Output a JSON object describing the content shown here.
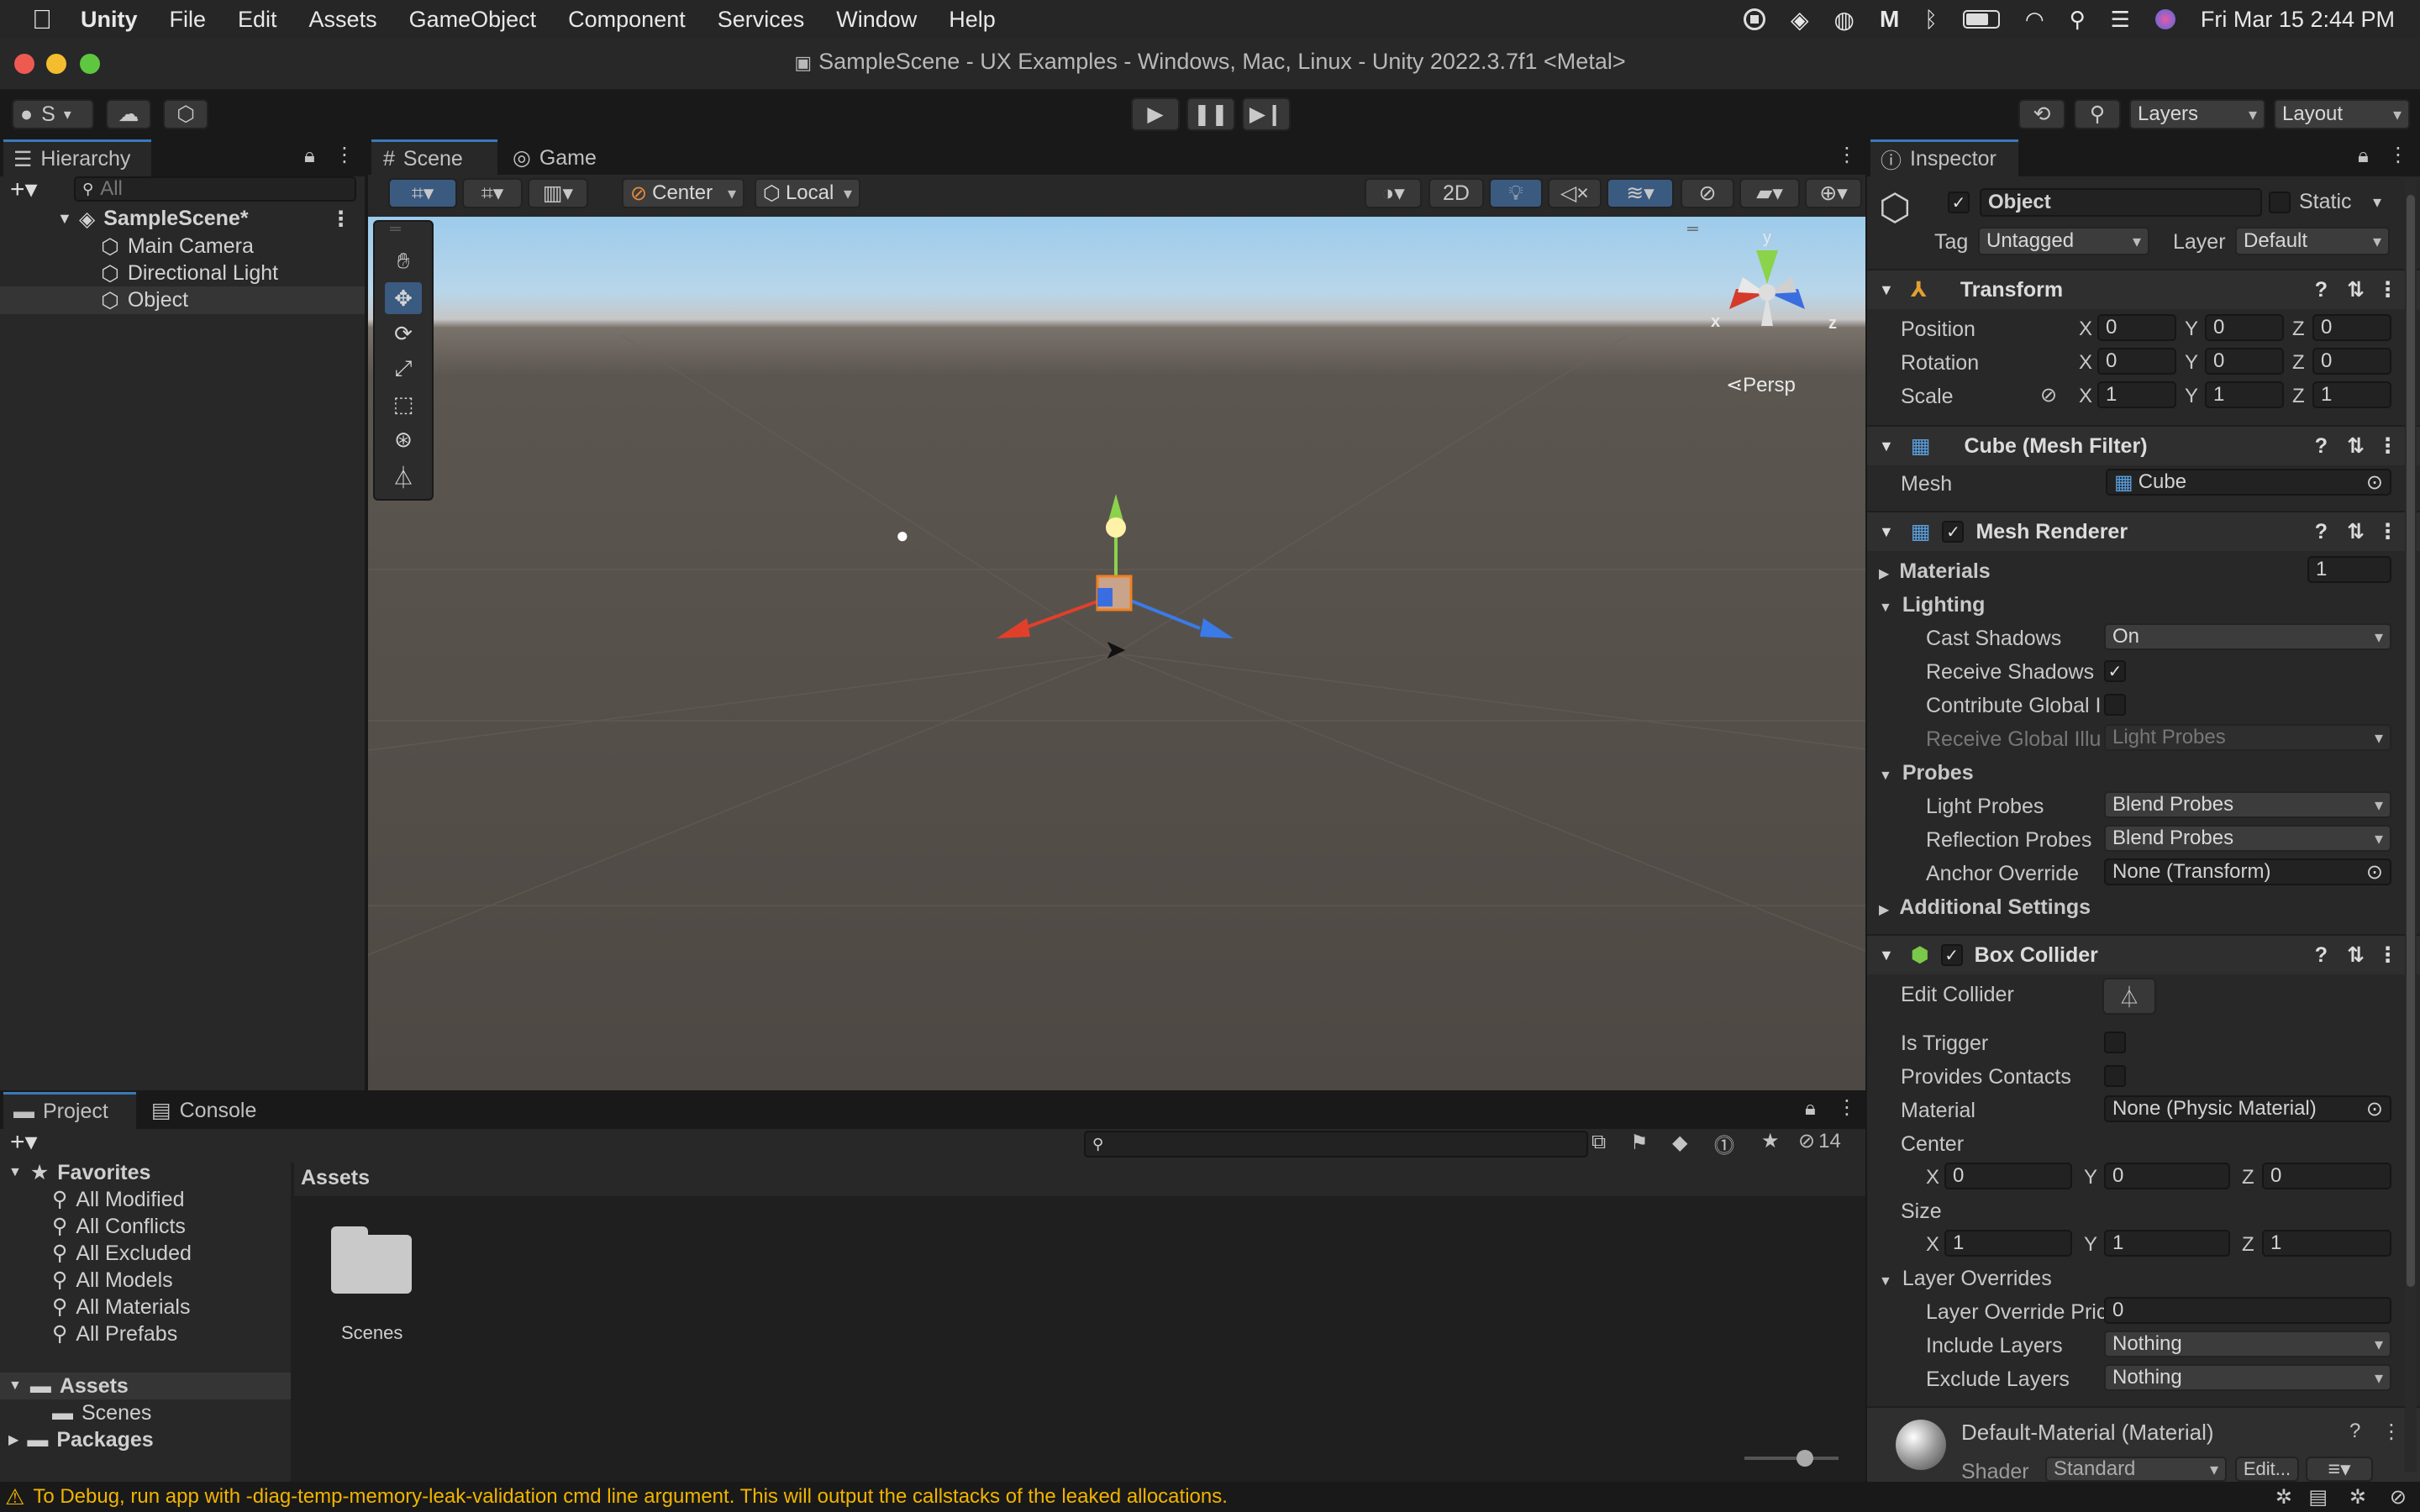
{
  "menubar": {
    "app": "Unity",
    "items": [
      "File",
      "Edit",
      "Assets",
      "GameObject",
      "Component",
      "Services",
      "Window",
      "Help"
    ],
    "datetime": "Fri Mar 15  2:44 PM"
  },
  "window": {
    "title": "SampleScene - UX Examples - Windows, Mac, Linux - Unity 2022.3.7f1 <Metal>"
  },
  "toolbar": {
    "account_label": "S",
    "layers_label": "Layers",
    "layout_label": "Layout"
  },
  "hierarchy": {
    "tab_label": "Hierarchy",
    "search_placeholder": "All",
    "scene_name": "SampleScene*",
    "items": [
      "Main Camera",
      "Directional Light",
      "Object"
    ]
  },
  "scene_view": {
    "tabs": [
      "Scene",
      "Game"
    ],
    "pivot_label": "Center",
    "space_label": "Local",
    "mode_2d": "2D",
    "persp_label": "Persp",
    "gizmo_x": "x",
    "gizmo_y": "y",
    "gizmo_z": "z"
  },
  "inspector": {
    "tab_label": "Inspector",
    "object_name": "Object",
    "static_label": "Static",
    "tag_label": "Tag",
    "tag_value": "Untagged",
    "layer_label": "Layer",
    "layer_value": "Default",
    "transform": {
      "title": "Transform",
      "position_label": "Position",
      "rotation_label": "Rotation",
      "scale_label": "Scale",
      "position": [
        "0",
        "0",
        "0"
      ],
      "rotation": [
        "0",
        "0",
        "0"
      ],
      "scale": [
        "1",
        "1",
        "1"
      ]
    },
    "mesh_filter": {
      "title": "Cube (Mesh Filter)",
      "mesh_label": "Mesh",
      "mesh_value": "Cube"
    },
    "mesh_renderer": {
      "title": "Mesh Renderer",
      "materials_label": "Materials",
      "materials_count": "1",
      "lighting_label": "Lighting",
      "cast_shadows_label": "Cast Shadows",
      "cast_shadows_value": "On",
      "receive_shadows_label": "Receive Shadows",
      "contribute_gi_label": "Contribute Global I",
      "receive_gi_label": "Receive Global Illu",
      "receive_gi_value": "Light Probes",
      "probes_label": "Probes",
      "light_probes_label": "Light Probes",
      "light_probes_value": "Blend Probes",
      "reflection_probes_label": "Reflection Probes",
      "reflection_probes_value": "Blend Probes",
      "anchor_override_label": "Anchor Override",
      "anchor_override_value": "None (Transform)",
      "additional_settings_label": "Additional Settings"
    },
    "box_collider": {
      "title": "Box Collider",
      "edit_collider_label": "Edit Collider",
      "is_trigger_label": "Is Trigger",
      "provides_contacts_label": "Provides Contacts",
      "material_label": "Material",
      "material_value": "None (Physic Material)",
      "center_label": "Center",
      "center": [
        "0",
        "0",
        "0"
      ],
      "size_label": "Size",
      "size": [
        "1",
        "1",
        "1"
      ],
      "layer_overrides_label": "Layer Overrides",
      "layer_override_priority_label": "Layer Override Pric",
      "layer_override_priority_value": "0",
      "include_layers_label": "Include Layers",
      "include_layers_value": "Nothing",
      "exclude_layers_label": "Exclude Layers",
      "exclude_layers_value": "Nothing"
    },
    "material": {
      "title": "Default-Material (Material)",
      "shader_label": "Shader",
      "shader_value": "Standard",
      "edit_label": "Edit..."
    },
    "axis": {
      "x": "X",
      "y": "Y",
      "z": "Z"
    }
  },
  "project": {
    "tabs": [
      "Project",
      "Console"
    ],
    "favorites_label": "Favorites",
    "favorites": [
      "All Modified",
      "All Conflicts",
      "All Excluded",
      "All Models",
      "All Materials",
      "All Prefabs"
    ],
    "assets_label": "Assets",
    "assets_children": [
      "Scenes"
    ],
    "packages_label": "Packages",
    "breadcrumb": "Assets",
    "folder_label": "Scenes",
    "hidden_count": "14"
  },
  "statusbar": {
    "message": "To Debug, run app with -diag-temp-memory-leak-validation cmd line argument. This will output the callstacks of the leaked allocations."
  },
  "colors": {
    "accent": "#3a79bb",
    "panel": "#282828",
    "background": "#191919",
    "warning": "#f0b400"
  }
}
